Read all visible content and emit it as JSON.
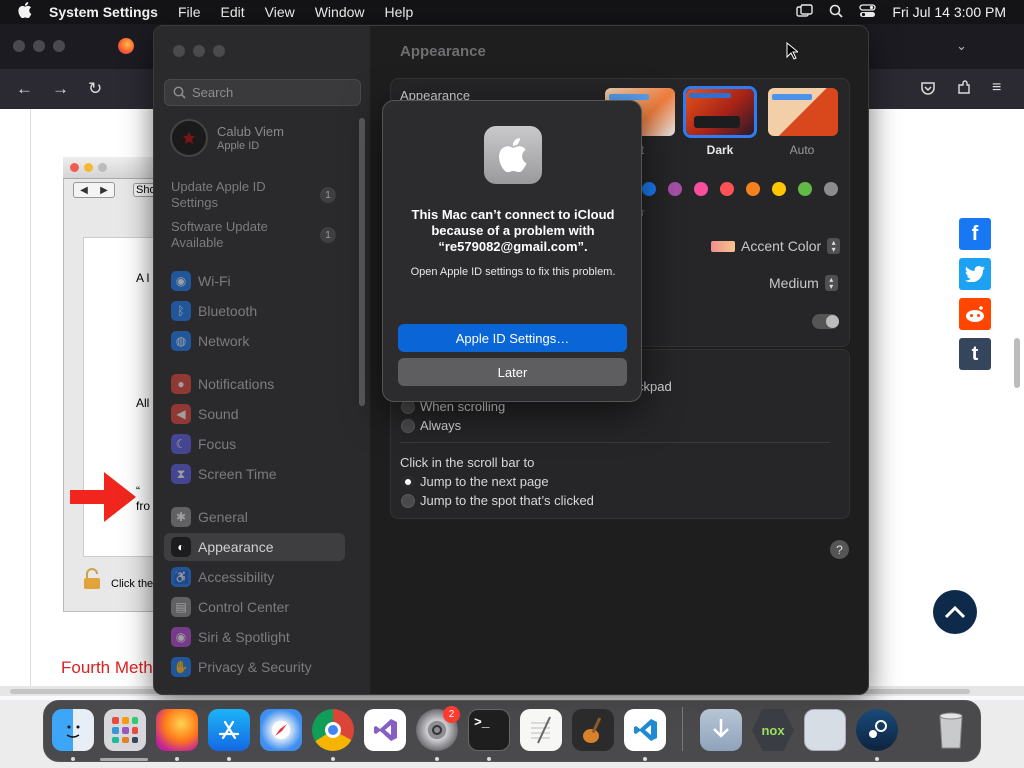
{
  "menubar": {
    "app_name": "System Settings",
    "items": [
      "File",
      "Edit",
      "View",
      "Window",
      "Help"
    ],
    "datetime": "Fri Jul 14  3:00 PM"
  },
  "browser": {
    "article": {
      "figure_button": "Sho",
      "figure_text1": "A l",
      "figure_text2": "All",
      "figure_text3": "“",
      "figure_text4": "fro",
      "figure_lock_text": "Click the",
      "section_heading": "Fourth Meth"
    }
  },
  "settings": {
    "search_placeholder": "Search",
    "account": {
      "name": "Calub Viem",
      "subtitle": "Apple ID"
    },
    "pending": [
      {
        "label": "Update Apple ID Settings",
        "count": "1"
      },
      {
        "label": "Software Update Available",
        "count": "1"
      }
    ],
    "sidebar_items": [
      {
        "label": "Wi-Fi",
        "icon": "wifi-icon",
        "color": "#1a7cf5"
      },
      {
        "label": "Bluetooth",
        "icon": "bluetooth-icon",
        "color": "#1a7cf5"
      },
      {
        "label": "Network",
        "icon": "globe-icon",
        "color": "#1a7cf5"
      },
      {
        "label": "Notifications",
        "icon": "bell-icon",
        "color": "#e5443a"
      },
      {
        "label": "Sound",
        "icon": "speaker-icon",
        "color": "#e5443a"
      },
      {
        "label": "Focus",
        "icon": "moon-icon",
        "color": "#5e5ce6"
      },
      {
        "label": "Screen Time",
        "icon": "hourglass-icon",
        "color": "#5e5ce6"
      },
      {
        "label": "General",
        "icon": "gear-icon",
        "color": "#8e8e93"
      },
      {
        "label": "Appearance",
        "icon": "appearance-icon",
        "color": "#1c1c1e"
      },
      {
        "label": "Accessibility",
        "icon": "accessibility-icon",
        "color": "#1a7cf5"
      },
      {
        "label": "Control Center",
        "icon": "control-center-icon",
        "color": "#8e8e93"
      },
      {
        "label": "Siri & Spotlight",
        "icon": "siri-icon",
        "color": "#b44ad6"
      },
      {
        "label": "Privacy & Security",
        "icon": "hand-icon",
        "color": "#1a7cf5"
      }
    ],
    "active_item": "Appearance",
    "main": {
      "title": "Appearance",
      "appearance_label": "Appearance",
      "themes": [
        {
          "label": "nt"
        },
        {
          "label": "Dark"
        },
        {
          "label": "Auto"
        }
      ],
      "accent_colors": [
        "#1a7cf5",
        "#a550a7",
        "#f74f9e",
        "#ff5257",
        "#f7821b",
        "#ffc600",
        "#62ba46",
        "#8c8c8c"
      ],
      "accent_caption": "or",
      "highlight_label": "Accent Color",
      "sidebar_icon_size": "Medium",
      "scroll_trackpad_fragment": "ckpad",
      "scroll_options": [
        "When scrolling",
        "Always"
      ],
      "click_scroll_label": "Click in the scroll bar to",
      "click_options": [
        "Jump to the next page",
        "Jump to the spot that’s clicked"
      ]
    }
  },
  "alert": {
    "title": "This Mac can’t connect to iCloud because of a problem with “re579082@gmail.com”.",
    "message": "Open Apple ID settings to fix this problem.",
    "primary_button": "Apple ID Settings…",
    "secondary_button": "Later"
  },
  "dock": {
    "settings_badge": "2",
    "apps": [
      "finder",
      "launchpad",
      "firefox",
      "app-store",
      "safari",
      "chrome",
      "visual-studio",
      "system-settings",
      "terminal",
      "textedit",
      "garageband",
      "vscode",
      "downloads",
      "nox",
      "preview",
      "steam",
      "trash"
    ]
  }
}
